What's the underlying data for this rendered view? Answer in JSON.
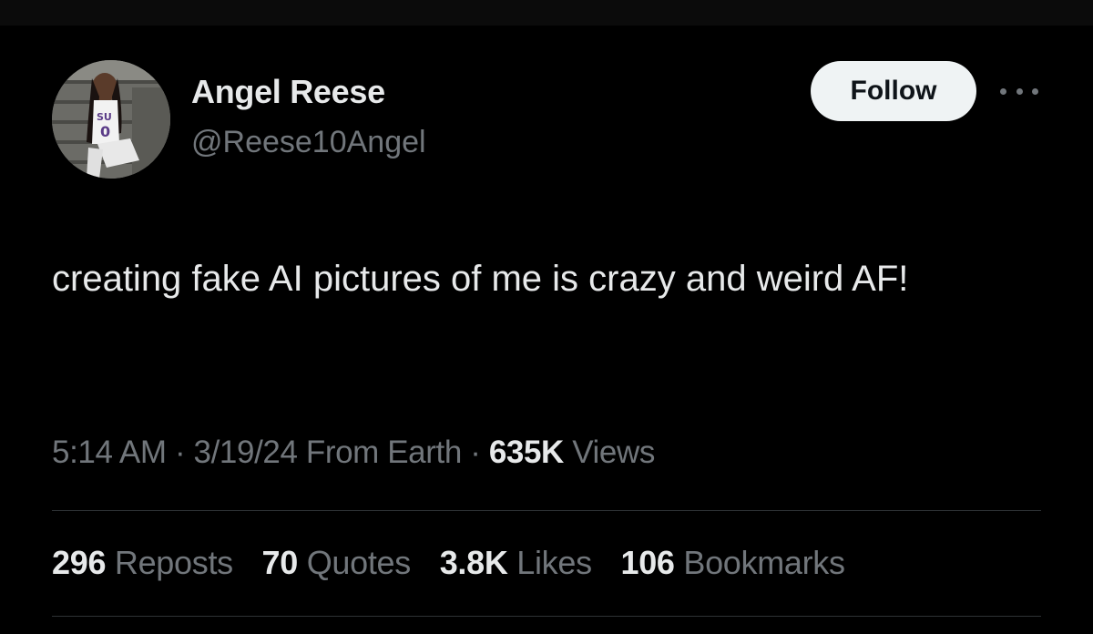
{
  "user": {
    "name": "Angel Reese",
    "handle": "@Reese10Angel",
    "avatar_icon": "profile-photo",
    "avatar_jersey_text": "SU",
    "avatar_jersey_number": "0"
  },
  "actions": {
    "follow_label": "Follow",
    "more_icon": "more-horizontal-icon"
  },
  "tweet": {
    "text": "creating fake AI pictures of me is crazy and weird AF!",
    "time": "5:14 AM",
    "date": "3/19/24",
    "source": "From Earth",
    "separator": "·",
    "views_count": "635K",
    "views_label": "Views"
  },
  "stats": {
    "reposts_count": "296",
    "reposts_label": "Reposts",
    "quotes_count": "70",
    "quotes_label": "Quotes",
    "likes_count": "3.8K",
    "likes_label": "Likes",
    "bookmarks_count": "106",
    "bookmarks_label": "Bookmarks"
  },
  "colors": {
    "background": "#000000",
    "primary_text": "#e7e9ea",
    "secondary_text": "#71767b",
    "divider": "#2f3336",
    "follow_bg": "#eff3f4"
  }
}
